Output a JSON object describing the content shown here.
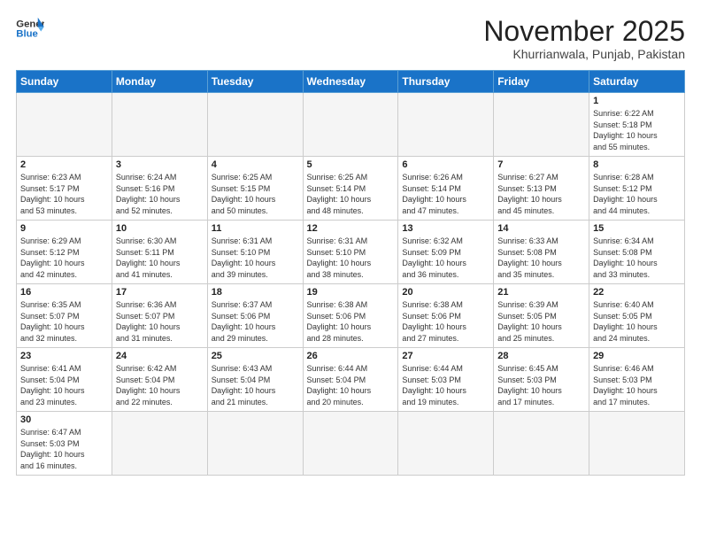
{
  "header": {
    "logo_line1": "General",
    "logo_line2": "Blue",
    "month": "November 2025",
    "location": "Khurrianwala, Punjab, Pakistan"
  },
  "weekdays": [
    "Sunday",
    "Monday",
    "Tuesday",
    "Wednesday",
    "Thursday",
    "Friday",
    "Saturday"
  ],
  "weeks": [
    [
      {
        "day": "",
        "info": ""
      },
      {
        "day": "",
        "info": ""
      },
      {
        "day": "",
        "info": ""
      },
      {
        "day": "",
        "info": ""
      },
      {
        "day": "",
        "info": ""
      },
      {
        "day": "",
        "info": ""
      },
      {
        "day": "1",
        "info": "Sunrise: 6:22 AM\nSunset: 5:18 PM\nDaylight: 10 hours\nand 55 minutes."
      }
    ],
    [
      {
        "day": "2",
        "info": "Sunrise: 6:23 AM\nSunset: 5:17 PM\nDaylight: 10 hours\nand 53 minutes."
      },
      {
        "day": "3",
        "info": "Sunrise: 6:24 AM\nSunset: 5:16 PM\nDaylight: 10 hours\nand 52 minutes."
      },
      {
        "day": "4",
        "info": "Sunrise: 6:25 AM\nSunset: 5:15 PM\nDaylight: 10 hours\nand 50 minutes."
      },
      {
        "day": "5",
        "info": "Sunrise: 6:25 AM\nSunset: 5:14 PM\nDaylight: 10 hours\nand 48 minutes."
      },
      {
        "day": "6",
        "info": "Sunrise: 6:26 AM\nSunset: 5:14 PM\nDaylight: 10 hours\nand 47 minutes."
      },
      {
        "day": "7",
        "info": "Sunrise: 6:27 AM\nSunset: 5:13 PM\nDaylight: 10 hours\nand 45 minutes."
      },
      {
        "day": "8",
        "info": "Sunrise: 6:28 AM\nSunset: 5:12 PM\nDaylight: 10 hours\nand 44 minutes."
      }
    ],
    [
      {
        "day": "9",
        "info": "Sunrise: 6:29 AM\nSunset: 5:12 PM\nDaylight: 10 hours\nand 42 minutes."
      },
      {
        "day": "10",
        "info": "Sunrise: 6:30 AM\nSunset: 5:11 PM\nDaylight: 10 hours\nand 41 minutes."
      },
      {
        "day": "11",
        "info": "Sunrise: 6:31 AM\nSunset: 5:10 PM\nDaylight: 10 hours\nand 39 minutes."
      },
      {
        "day": "12",
        "info": "Sunrise: 6:31 AM\nSunset: 5:10 PM\nDaylight: 10 hours\nand 38 minutes."
      },
      {
        "day": "13",
        "info": "Sunrise: 6:32 AM\nSunset: 5:09 PM\nDaylight: 10 hours\nand 36 minutes."
      },
      {
        "day": "14",
        "info": "Sunrise: 6:33 AM\nSunset: 5:08 PM\nDaylight: 10 hours\nand 35 minutes."
      },
      {
        "day": "15",
        "info": "Sunrise: 6:34 AM\nSunset: 5:08 PM\nDaylight: 10 hours\nand 33 minutes."
      }
    ],
    [
      {
        "day": "16",
        "info": "Sunrise: 6:35 AM\nSunset: 5:07 PM\nDaylight: 10 hours\nand 32 minutes."
      },
      {
        "day": "17",
        "info": "Sunrise: 6:36 AM\nSunset: 5:07 PM\nDaylight: 10 hours\nand 31 minutes."
      },
      {
        "day": "18",
        "info": "Sunrise: 6:37 AM\nSunset: 5:06 PM\nDaylight: 10 hours\nand 29 minutes."
      },
      {
        "day": "19",
        "info": "Sunrise: 6:38 AM\nSunset: 5:06 PM\nDaylight: 10 hours\nand 28 minutes."
      },
      {
        "day": "20",
        "info": "Sunrise: 6:38 AM\nSunset: 5:06 PM\nDaylight: 10 hours\nand 27 minutes."
      },
      {
        "day": "21",
        "info": "Sunrise: 6:39 AM\nSunset: 5:05 PM\nDaylight: 10 hours\nand 25 minutes."
      },
      {
        "day": "22",
        "info": "Sunrise: 6:40 AM\nSunset: 5:05 PM\nDaylight: 10 hours\nand 24 minutes."
      }
    ],
    [
      {
        "day": "23",
        "info": "Sunrise: 6:41 AM\nSunset: 5:04 PM\nDaylight: 10 hours\nand 23 minutes."
      },
      {
        "day": "24",
        "info": "Sunrise: 6:42 AM\nSunset: 5:04 PM\nDaylight: 10 hours\nand 22 minutes."
      },
      {
        "day": "25",
        "info": "Sunrise: 6:43 AM\nSunset: 5:04 PM\nDaylight: 10 hours\nand 21 minutes."
      },
      {
        "day": "26",
        "info": "Sunrise: 6:44 AM\nSunset: 5:04 PM\nDaylight: 10 hours\nand 20 minutes."
      },
      {
        "day": "27",
        "info": "Sunrise: 6:44 AM\nSunset: 5:03 PM\nDaylight: 10 hours\nand 19 minutes."
      },
      {
        "day": "28",
        "info": "Sunrise: 6:45 AM\nSunset: 5:03 PM\nDaylight: 10 hours\nand 17 minutes."
      },
      {
        "day": "29",
        "info": "Sunrise: 6:46 AM\nSunset: 5:03 PM\nDaylight: 10 hours\nand 17 minutes."
      }
    ],
    [
      {
        "day": "30",
        "info": "Sunrise: 6:47 AM\nSunset: 5:03 PM\nDaylight: 10 hours\nand 16 minutes."
      },
      {
        "day": "",
        "info": ""
      },
      {
        "day": "",
        "info": ""
      },
      {
        "day": "",
        "info": ""
      },
      {
        "day": "",
        "info": ""
      },
      {
        "day": "",
        "info": ""
      },
      {
        "day": "",
        "info": ""
      }
    ]
  ]
}
